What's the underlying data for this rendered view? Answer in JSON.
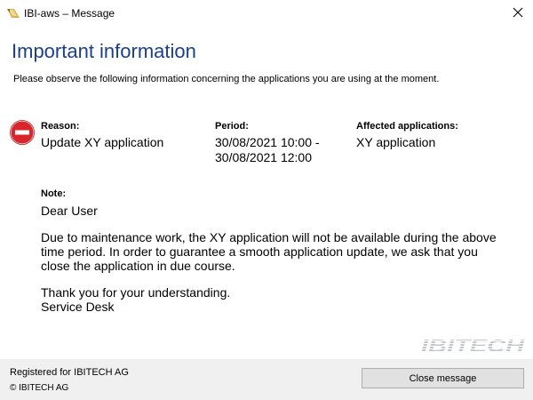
{
  "window": {
    "title": "IBI-aws – Message",
    "icons": {
      "app": "ibi-aws-app-icon",
      "close": "close-icon"
    }
  },
  "message": {
    "heading": "Important information",
    "intro": "Please observe the following information concerning the applications you are using at the moment.",
    "status_icon": "stop-icon",
    "reason": {
      "label": "Reason:",
      "value": "Update XY application"
    },
    "period": {
      "label": "Period:",
      "start": "30/08/2021 10:00 -",
      "end": "30/08/2021 12:00"
    },
    "affected": {
      "label": "Affected applications:",
      "value": "XY application"
    },
    "note": {
      "label": "Note:",
      "paragraphs": [
        "Dear User",
        "Due to maintenance work, the XY application will not be available during the above time period. In order to guarantee a smooth application update, we ask that you close the application in due course.",
        "Thank you for your understanding.\nService Desk"
      ]
    }
  },
  "branding": {
    "logo_text": "IBITECH",
    "logo_color": "#c2c6cc"
  },
  "footer": {
    "registered": "Registered for IBITECH AG",
    "copyright": "© IBITECH AG",
    "close_button": "Close message"
  },
  "colors": {
    "heading": "#1b3f8f",
    "stop_icon": "#d9262b",
    "footer_bg": "#f0f0f0"
  }
}
